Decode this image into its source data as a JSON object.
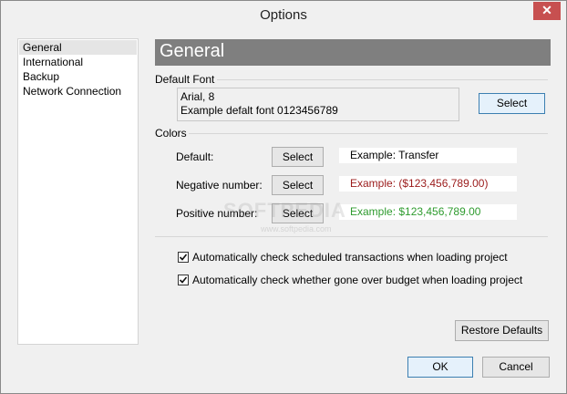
{
  "window": {
    "title": "Options",
    "close_glyph": "✕"
  },
  "nav": {
    "items": [
      {
        "label": "General"
      },
      {
        "label": "International"
      },
      {
        "label": "Backup"
      },
      {
        "label": "Network Connection"
      }
    ]
  },
  "header": {
    "title": "General"
  },
  "default_font": {
    "section_label": "Default Font",
    "font_name": "Arial, 8",
    "example": "Example defalt font 0123456789",
    "select_label": "Select"
  },
  "colors": {
    "section_label": "Colors",
    "rows": [
      {
        "label": "Default:",
        "button": "Select",
        "example": "Example: Transfer",
        "color": "#000000"
      },
      {
        "label": "Negative number:",
        "button": "Select",
        "example": "Example: ($123,456,789.00)",
        "color": "#9b1b1b"
      },
      {
        "label": "Positive number:",
        "button": "Select",
        "example": "Example: $123,456,789.00",
        "color": "#2e9b2e"
      }
    ]
  },
  "checks": [
    {
      "label": "Automatically check scheduled transactions when loading project",
      "checked": true
    },
    {
      "label": "Automatically check whether gone over budget when loading project",
      "checked": true
    }
  ],
  "restore_defaults_label": "Restore Defaults",
  "ok_label": "OK",
  "cancel_label": "Cancel",
  "watermark": {
    "main": "SOFTPEDIA",
    "sub": "www.softpedia.com"
  }
}
